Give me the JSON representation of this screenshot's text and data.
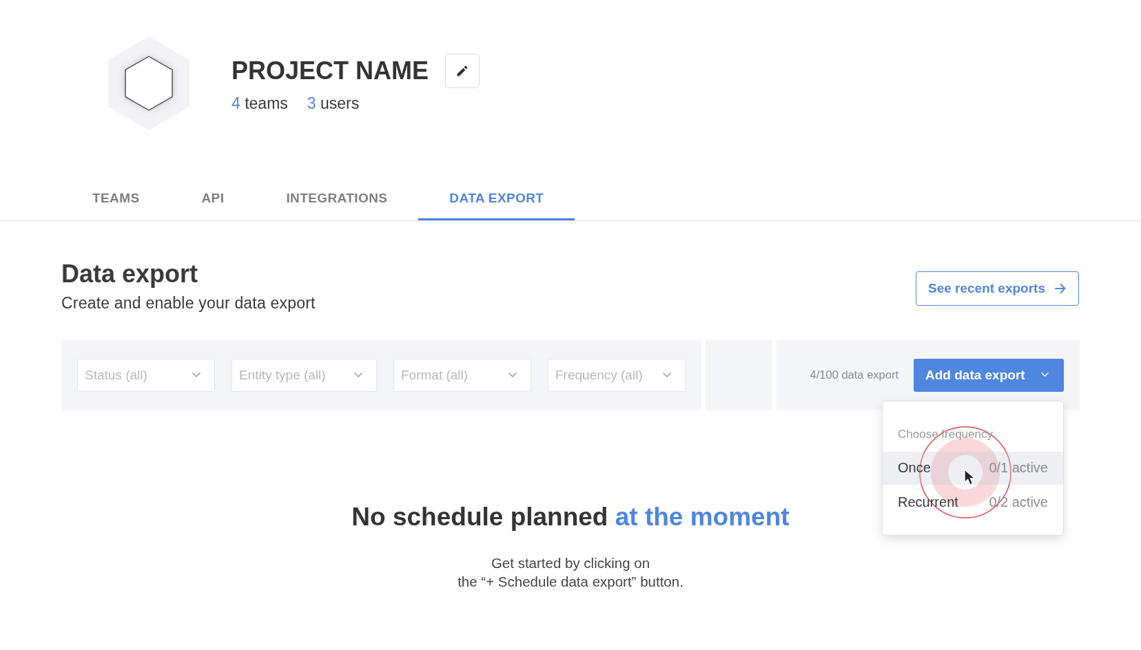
{
  "project": {
    "name": "PROJECT NAME",
    "stats": [
      {
        "count": "4",
        "label": "teams"
      },
      {
        "count": "3",
        "label": "users"
      }
    ]
  },
  "tabs": [
    {
      "label": "TEAMS",
      "selected": false
    },
    {
      "label": "API",
      "selected": false
    },
    {
      "label": "INTEGRATIONS",
      "selected": false
    },
    {
      "label": "DATA EXPORT",
      "selected": true
    }
  ],
  "section": {
    "title": "Data export",
    "subtitle": "Create and enable your data export",
    "recent_button": "See recent exports"
  },
  "toolbar": {
    "filters": [
      {
        "placeholder": "Status (all)"
      },
      {
        "placeholder": "Entity type (all)"
      },
      {
        "placeholder": "Format (all)"
      },
      {
        "placeholder": "Frequency (all)"
      }
    ],
    "quota": "4/100 data export",
    "add_button": {
      "label": "Add data export",
      "expanded": true
    },
    "menu": {
      "heading": "Choose frequency",
      "items": [
        {
          "label": "Once",
          "count": "0/1 active",
          "selected": true
        },
        {
          "label": "Recurrent",
          "count": "0/2 active",
          "selected": false
        }
      ]
    }
  },
  "empty_state": {
    "title": "No schedule planned",
    "title_accent": "at the moment",
    "hint_lines": [
      "Get started by clicking on",
      "the “+ Schedule data export” button."
    ]
  }
}
